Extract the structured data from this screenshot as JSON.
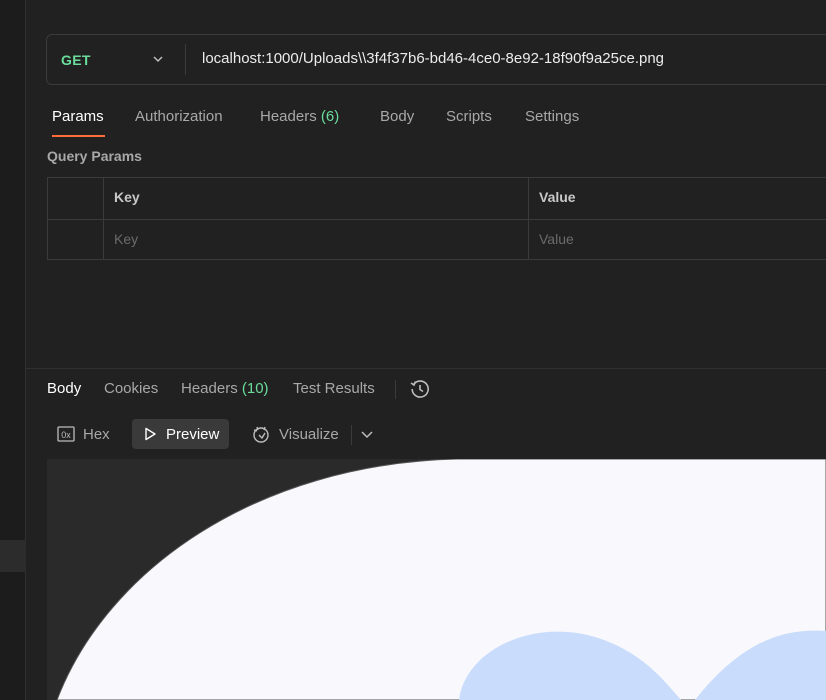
{
  "request": {
    "method": "GET",
    "url": "localhost:1000/Uploads\\\\3f4f37b6-bd46-4ce0-8e92-18f90f9a25ce.png"
  },
  "request_tabs": [
    {
      "label": "Params",
      "count": ""
    },
    {
      "label": "Authorization",
      "count": ""
    },
    {
      "label": "Headers",
      "count": "(6)"
    },
    {
      "label": "Body",
      "count": ""
    },
    {
      "label": "Scripts",
      "count": ""
    },
    {
      "label": "Settings",
      "count": ""
    }
  ],
  "query_params": {
    "title": "Query Params",
    "columns": [
      "Key",
      "Value"
    ],
    "placeholders": {
      "key": "Key",
      "value": "Value"
    }
  },
  "response_tabs": [
    {
      "label": "Body",
      "count": ""
    },
    {
      "label": "Cookies",
      "count": ""
    },
    {
      "label": "Headers",
      "count": "(10)"
    },
    {
      "label": "Test Results",
      "count": ""
    }
  ],
  "view_modes": {
    "hex": "Hex",
    "preview": "Preview",
    "visualize": "Visualize"
  },
  "colors": {
    "accent": "#ff6c37",
    "method_get": "#6bdd9a",
    "image_bg": "#f8f8fd",
    "image_shape": "#c9dcfb"
  }
}
